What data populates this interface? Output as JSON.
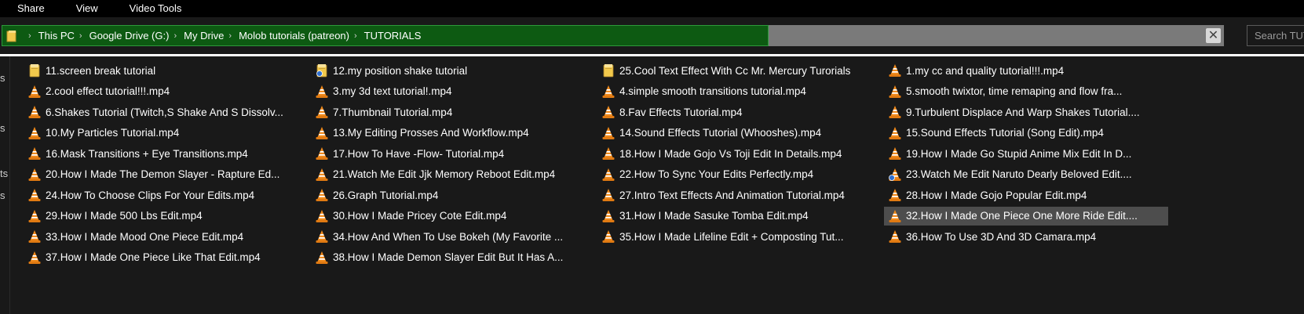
{
  "ribbon": {
    "tabs": [
      "Share",
      "View",
      "Video Tools"
    ]
  },
  "address": {
    "crumbs": [
      "This PC",
      "Google Drive (G:)",
      "My Drive",
      "Molob tutorials (patreon)",
      "TUTORIALS"
    ],
    "search_placeholder": "Search TUTORIALS",
    "clear_glyph": "✕"
  },
  "nav_edge_letters": [
    "s",
    "s",
    "ts",
    "s"
  ],
  "colors": {
    "address_fill": "#0d5a12",
    "address_border": "#2d9a3a",
    "address_rest": "#7a7a7a",
    "background": "#191919",
    "selection": "#4d4d4d"
  },
  "files": [
    {
      "name": "11.screen break tutorial",
      "icon": "folder-icon"
    },
    {
      "name": "12.my position shake tutorial",
      "icon": "folder-sync-icon"
    },
    {
      "name": "25.Cool Text Effect With Cc Mr. Mercury Turorials",
      "icon": "folder-icon"
    },
    {
      "name": "1.my cc and quality tutorial!!!.mp4",
      "icon": "vlc-cone-icon"
    },
    {
      "name": "2.cool effect tutorial!!!.mp4",
      "icon": "vlc-cone-icon"
    },
    {
      "name": "3.my 3d text tutorial!.mp4",
      "icon": "vlc-cone-icon"
    },
    {
      "name": "4.simple smooth transitions tutorial.mp4",
      "icon": "vlc-cone-icon"
    },
    {
      "name": "5.smooth twixtor, time remaping and flow fra...",
      "icon": "vlc-cone-icon"
    },
    {
      "name": "6.Shakes Tutorial (Twitch,S Shake And S Dissolv...",
      "icon": "vlc-cone-icon"
    },
    {
      "name": "7.Thumbnail Tutorial.mp4",
      "icon": "vlc-cone-icon"
    },
    {
      "name": "8.Fav Effects Tutorial.mp4",
      "icon": "vlc-cone-icon"
    },
    {
      "name": "9.Turbulent Displace And Warp Shakes Tutorial....",
      "icon": "vlc-cone-icon"
    },
    {
      "name": "10.My Particles Tutorial.mp4",
      "icon": "vlc-cone-icon"
    },
    {
      "name": "13.My Editing Prosses And Workflow.mp4",
      "icon": "vlc-cone-icon"
    },
    {
      "name": "14.Sound Effects Tutorial (Whooshes).mp4",
      "icon": "vlc-cone-icon"
    },
    {
      "name": "15.Sound Effects Tutorial (Song Edit).mp4",
      "icon": "vlc-cone-icon"
    },
    {
      "name": "16.Mask Transitions + Eye Transitions.mp4",
      "icon": "vlc-cone-icon"
    },
    {
      "name": "17.How To Have -Flow- Tutorial.mp4",
      "icon": "vlc-cone-icon"
    },
    {
      "name": "18.How I Made Gojo Vs Toji Edit In Details.mp4",
      "icon": "vlc-cone-icon"
    },
    {
      "name": "19.How I Made Go Stupid Anime Mix Edit In D...",
      "icon": "vlc-cone-icon"
    },
    {
      "name": "20.How I Made The Demon Slayer - Rapture Ed...",
      "icon": "vlc-cone-icon"
    },
    {
      "name": "21.Watch Me Edit Jjk Memory Reboot Edit.mp4",
      "icon": "vlc-cone-icon"
    },
    {
      "name": "22.How To Sync Your Edits Perfectly.mp4",
      "icon": "vlc-cone-icon"
    },
    {
      "name": "23.Watch Me Edit Naruto Dearly Beloved Edit....",
      "icon": "vlc-cone-sync-icon"
    },
    {
      "name": "24.How To Choose Clips For Your Edits.mp4",
      "icon": "vlc-cone-icon"
    },
    {
      "name": "26.Graph Tutorial.mp4",
      "icon": "vlc-cone-icon"
    },
    {
      "name": "27.Intro Text Effects And Animation Tutorial.mp4",
      "icon": "vlc-cone-icon"
    },
    {
      "name": "28.How I Made Gojo Popular Edit.mp4",
      "icon": "vlc-cone-icon"
    },
    {
      "name": "29.How I Made 500 Lbs Edit.mp4",
      "icon": "vlc-cone-icon"
    },
    {
      "name": "30.How I Made Pricey Cote Edit.mp4",
      "icon": "vlc-cone-icon"
    },
    {
      "name": "31.How I Made Sasuke Tomba Edit.mp4",
      "icon": "vlc-cone-icon"
    },
    {
      "name": "32.How I Made One Piece One More Ride Edit....",
      "icon": "vlc-cone-icon",
      "selected": true
    },
    {
      "name": "33.How I Made Mood One Piece Edit.mp4",
      "icon": "vlc-cone-icon"
    },
    {
      "name": "34.How And When To Use Bokeh (My Favorite ...",
      "icon": "vlc-cone-icon"
    },
    {
      "name": "35.How I Made Lifeline Edit + Composting Tut...",
      "icon": "vlc-cone-icon"
    },
    {
      "name": "36.How To Use 3D And 3D Camara.mp4",
      "icon": "vlc-cone-icon"
    },
    {
      "name": "37.How I Made One Piece Like That Edit.mp4",
      "icon": "vlc-cone-icon"
    },
    {
      "name": "38.How I Made Demon Slayer Edit But It Has A...",
      "icon": "vlc-cone-icon"
    }
  ]
}
